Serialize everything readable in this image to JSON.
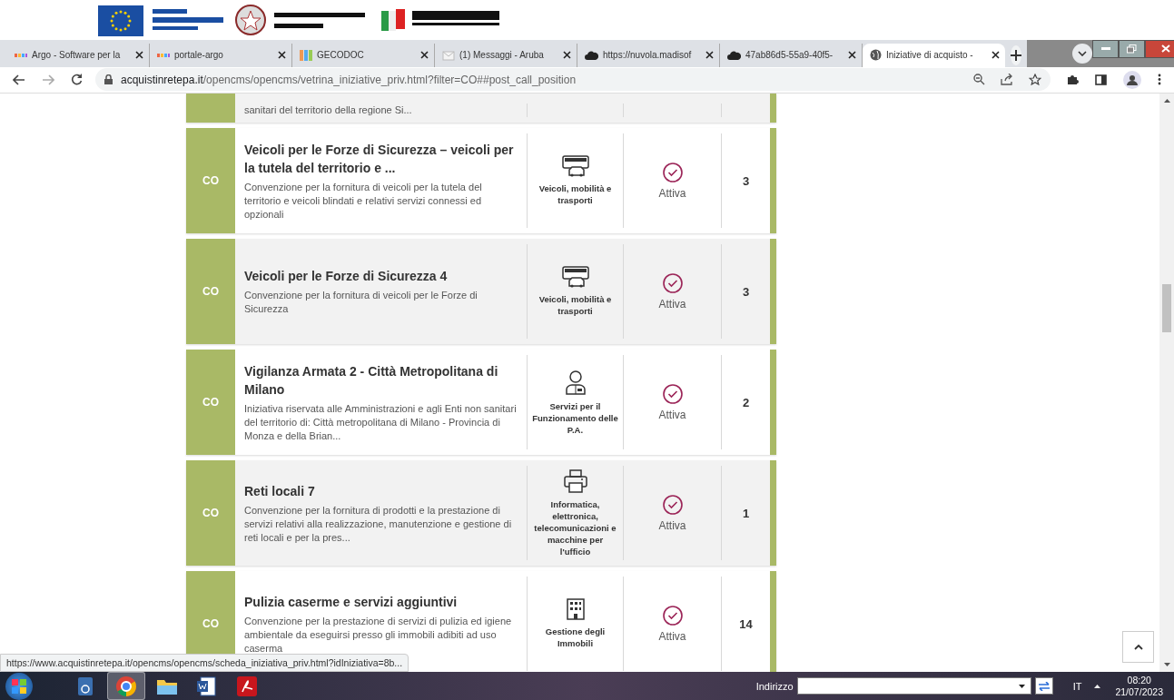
{
  "browser": {
    "tabs": [
      {
        "title": "Argo - Software per la",
        "kind": "dots",
        "selected": false
      },
      {
        "title": "portale-argo",
        "kind": "dots",
        "selected": false
      },
      {
        "title": "GECODOC",
        "kind": "grid",
        "selected": false
      },
      {
        "title": "(1) Messaggi - Aruba",
        "kind": "mail",
        "selected": false
      },
      {
        "title": "https://nuvola.madisof",
        "kind": "cloud",
        "selected": false
      },
      {
        "title": "47ab86d5-55a9-40f5-",
        "kind": "cloud",
        "selected": false
      },
      {
        "title": "Iniziative di acquisto -",
        "kind": "globe",
        "selected": true
      }
    ],
    "url_host": "acquistinretepa.it",
    "url_path": "/opencms/opencms/vetrina_iniziative_priv.html?filter=CO##post_call_position"
  },
  "partial_row": {
    "description": "sanitari del territorio della regione Si..."
  },
  "rows": [
    {
      "badge": "CO",
      "title": "Veicoli per le Forze di Sicurezza – veicoli per la tutela del territorio e ...",
      "description": "Convenzione per la fornitura di veicoli per la tutela del territorio e veicoli blindati e relativi servizi connessi ed opzionali",
      "kind": "vehicles",
      "category": "Veicoli, mobilità e trasporti",
      "status": "Attiva",
      "count": "3"
    },
    {
      "badge": "CO",
      "title": "Veicoli per le Forze di Sicurezza 4",
      "description": "Convenzione per la fornitura di veicoli per le Forze di Sicurezza",
      "kind": "vehicles",
      "category": "Veicoli, mobilità e trasporti",
      "status": "Attiva",
      "count": "3"
    },
    {
      "badge": "CO",
      "title": "Vigilanza Armata 2 - Città Metropolitana di Milano",
      "description": "Iniziativa riservata alle Amministrazioni e agli Enti non sanitari del territorio di: Città metropolitana di Milano - Provincia di Monza e della Brian...",
      "kind": "person",
      "category": "Servizi per il Funzionamento delle P.A.",
      "status": "Attiva",
      "count": "2"
    },
    {
      "badge": "CO",
      "title": "Reti locali 7",
      "description": "Convenzione per la fornitura di prodotti e la prestazione di servizi relativi alla realizzazione, manutenzione e gestione di reti locali e per la pres...",
      "kind": "printer",
      "category": "Informatica, elettronica, telecomunicazioni e macchine per l'ufficio",
      "status": "Attiva",
      "count": "1"
    },
    {
      "badge": "CO",
      "title": "Pulizia caserme e servizi aggiuntivi",
      "description": "Convenzione per la prestazione di servizi di pulizia ed igiene ambientale da eseguirsi presso gli immobili adibiti ad uso caserma",
      "kind": "building",
      "category": "Gestione degli Immobili",
      "status": "Attiva",
      "count": "14"
    }
  ],
  "status_url": "https://www.acquistinretepa.it/opencms/opencms/scheda_iniziativa_priv.html?idIniziativa=8b...",
  "taskbar": {
    "address_label": "Indirizzo",
    "language": "IT",
    "time": "08:20",
    "date": "21/07/2023"
  }
}
